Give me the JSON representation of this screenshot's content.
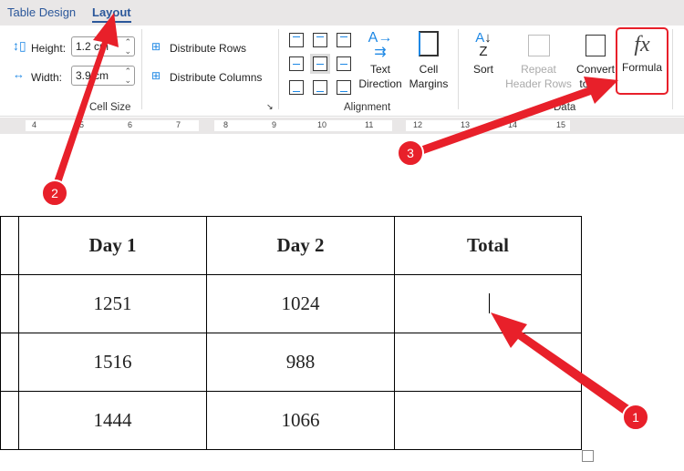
{
  "tabs": [
    {
      "label": "Table Design"
    },
    {
      "label": "Layout",
      "active": true
    }
  ],
  "cell_size": {
    "height_label": "Height:",
    "height_value": "1.2 cm",
    "width_label": "Width:",
    "width_value": "3.9 cm",
    "distribute_rows": "Distribute Rows",
    "distribute_columns": "Distribute Columns",
    "group_label": "Cell Size"
  },
  "alignment": {
    "text_direction": [
      "Text",
      "Direction"
    ],
    "cell_margins": [
      "Cell",
      "Margins"
    ],
    "group_label": "Alignment"
  },
  "data_group": {
    "sort": "Sort",
    "repeat_header_rows": [
      "Repeat",
      "Header Rows"
    ],
    "convert_to_text": [
      "Convert",
      "to Text"
    ],
    "formula": "Formula",
    "formula_icon": "fx",
    "group_label": "Data"
  },
  "ruler": [
    "4",
    "5",
    "6",
    "7",
    "8",
    "9",
    "10",
    "11",
    "12",
    "13",
    "14",
    "15"
  ],
  "table": {
    "headers": [
      "Day 1",
      "Day 2",
      "Total"
    ],
    "rows": [
      [
        "1251",
        "1024",
        ""
      ],
      [
        "1516",
        "988",
        ""
      ],
      [
        "1444",
        "1066",
        ""
      ]
    ]
  },
  "annotations": {
    "color": "#e8202a",
    "steps": [
      "1",
      "2",
      "3"
    ]
  }
}
